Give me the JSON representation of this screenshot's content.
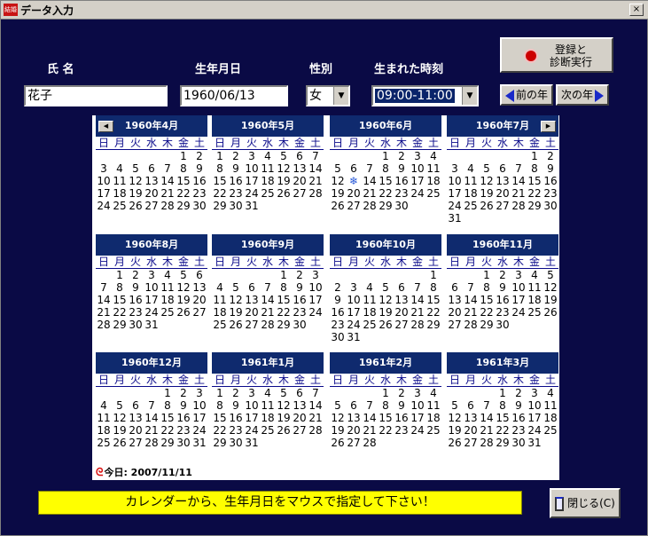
{
  "window": {
    "title": "データ入力",
    "app_icon": "結婚",
    "close_glyph": "×"
  },
  "labels": {
    "name": "氏 名",
    "birthdate": "生年月日",
    "gender": "性別",
    "birthtime": "生まれた時刻"
  },
  "fields": {
    "name": "花子",
    "birthdate": "1960/06/13",
    "gender": "女",
    "birthtime": "09:00-11:00"
  },
  "buttons": {
    "register": "登録と\n診断実行",
    "prev_year": "前の年",
    "next_year": "次の年",
    "close": "閉じる(C)"
  },
  "weekdays": [
    "日",
    "月",
    "火",
    "水",
    "木",
    "金",
    "土"
  ],
  "calendar": {
    "today_label": "今日: 2007/11/11",
    "selected": "1960/06/13",
    "months": [
      {
        "title": "1960年4月",
        "offset": 5,
        "days": 30
      },
      {
        "title": "1960年5月",
        "offset": 0,
        "days": 31
      },
      {
        "title": "1960年6月",
        "offset": 3,
        "days": 30
      },
      {
        "title": "1960年7月",
        "offset": 5,
        "days": 31
      },
      {
        "title": "1960年8月",
        "offset": 1,
        "days": 31
      },
      {
        "title": "1960年9月",
        "offset": 4,
        "days": 30
      },
      {
        "title": "1960年10月",
        "offset": 6,
        "days": 31
      },
      {
        "title": "1960年11月",
        "offset": 2,
        "days": 30
      },
      {
        "title": "1960年12月",
        "offset": 4,
        "days": 31
      },
      {
        "title": "1961年1月",
        "offset": 0,
        "days": 31
      },
      {
        "title": "1961年2月",
        "offset": 3,
        "days": 28
      },
      {
        "title": "1961年3月",
        "offset": 3,
        "days": 31
      }
    ]
  },
  "message": "カレンダーから、生年月日をマウスで指定して下さい！",
  "icons": {
    "app": "app-icon",
    "close": "close-icon",
    "register": "record-icon",
    "prev": "triangle-left-icon",
    "next": "triangle-right-icon",
    "today": "today-icon",
    "exit": "door-icon"
  }
}
